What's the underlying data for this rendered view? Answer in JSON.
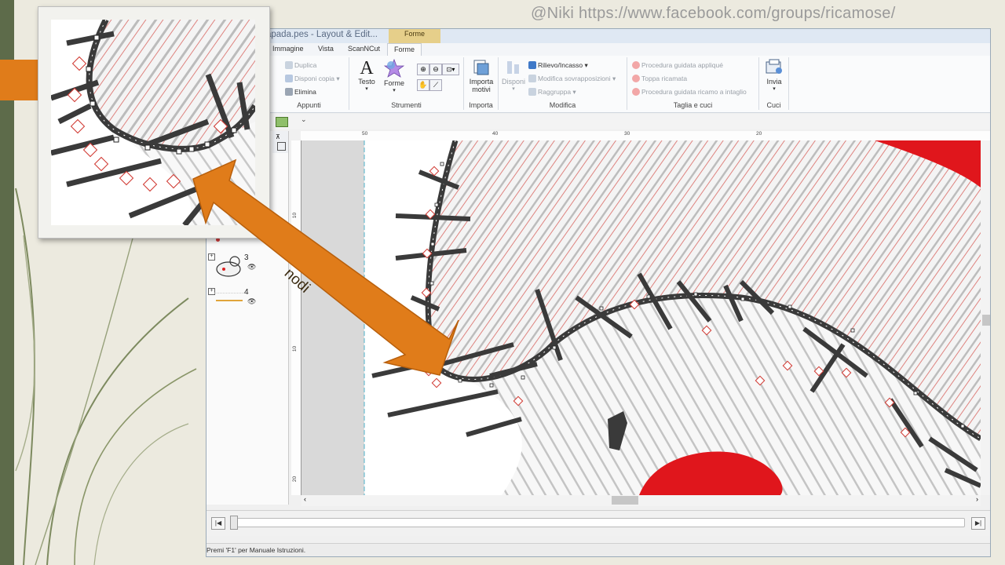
{
  "credit": "@Niki  https://www.facebook.com/groups/ricamose/",
  "window": {
    "title": "apada.pes - Layout & Edit...",
    "context_tab": "Forme"
  },
  "tabs": [
    {
      "label": "Immagine"
    },
    {
      "label": "Vista"
    },
    {
      "label": "ScanNCut"
    },
    {
      "label": "Forme",
      "active": true
    }
  ],
  "ribbon": {
    "appunti": {
      "label": "Appunti",
      "duplica": "Duplica",
      "disponi_copia": "Disponi copia",
      "elimina": "Elimina"
    },
    "strumenti": {
      "label": "Strumenti",
      "testo": "Testo",
      "forme": "Forme"
    },
    "importa": {
      "label": "Importa",
      "importa_motivi_1": "Importa",
      "importa_motivi_2": "motivi"
    },
    "modifica": {
      "label": "Modifica",
      "disponi": "Disponi",
      "rilievo": "Rilievo/Incasso",
      "modifica_sovrapposizioni": "Modifica sovrapposizioni",
      "raggruppa": "Raggruppa"
    },
    "taglia_cuci": {
      "label": "Taglia e cuci",
      "procedura_applique": "Procedura guidata appliqué",
      "toppa_ricamata": "Toppa ricamata",
      "procedura_intaglio": "Procedura guidata ricamo a intaglio"
    },
    "cuci": {
      "label": "Cuci",
      "invia": "Invia"
    }
  },
  "rulers": {
    "top": [
      "50",
      "40",
      "30",
      "20"
    ],
    "left": [
      "10",
      "10",
      "20"
    ]
  },
  "layers": [
    {
      "number": "3"
    },
    {
      "number": "4"
    }
  ],
  "annotation": {
    "label": "nodi"
  },
  "status": {
    "text": "Premi 'F1' per Manuale Istruzioni."
  },
  "colors": {
    "accent_orange": "#e07c1a",
    "stitch_dark": "#3a3a3a",
    "fill_red": "#e0161c",
    "ribbon_bg": "#fafbfc"
  }
}
